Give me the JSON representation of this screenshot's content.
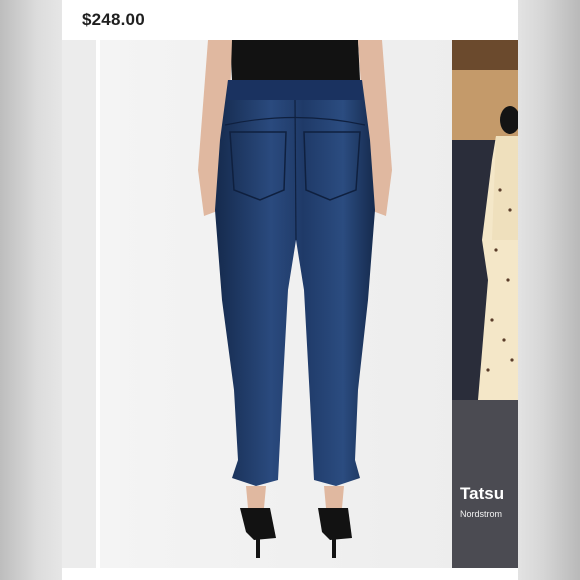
{
  "listing": {
    "price": "$248.00"
  },
  "carousel": {
    "next_slide": {
      "caption_title": "Tatsu",
      "caption_subtitle": "Nordstrom"
    }
  },
  "colors": {
    "denim": "#1f3a68",
    "denim_dark": "#152a4d",
    "top": "#121212",
    "skin": "#e0b8a0"
  }
}
